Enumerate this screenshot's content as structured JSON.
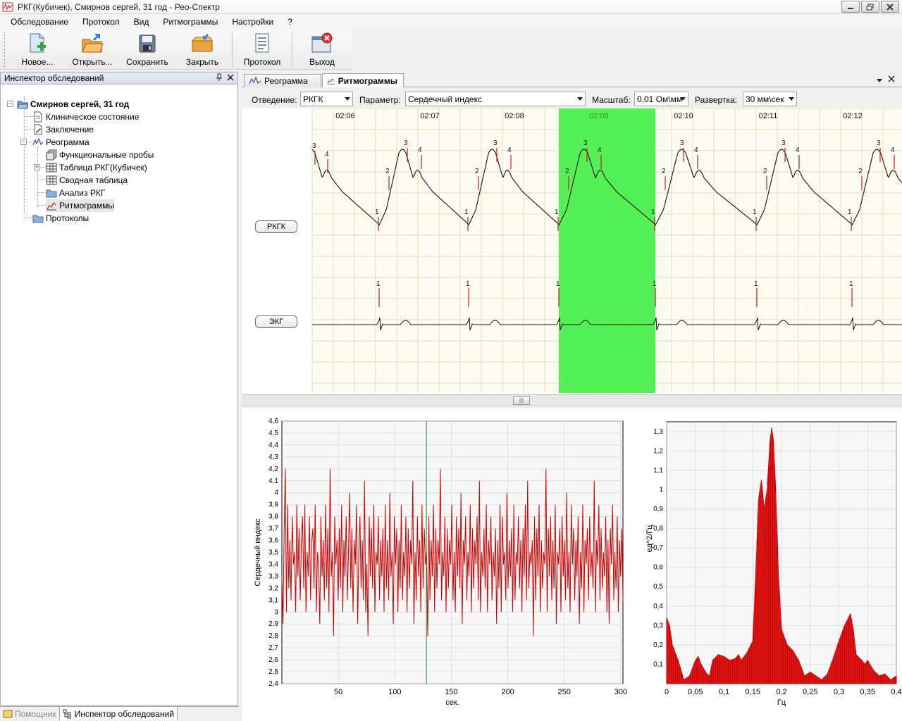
{
  "window": {
    "title": "РКГ(Кубичек), Смирнов сергей, 31 год - Рео-Спектр"
  },
  "menu": [
    "Обследование",
    "Протокол",
    "Вид",
    "Ритмограммы",
    "Настройки",
    "?"
  ],
  "toolbar": {
    "buttons": [
      {
        "label": "Новое...",
        "icon": "new-document-icon"
      },
      {
        "label": "Открыть...",
        "icon": "open-folder-icon"
      },
      {
        "label": "Сохранить",
        "icon": "save-disk-icon"
      },
      {
        "label": "Закрыть",
        "icon": "close-folder-icon"
      },
      {
        "label": "Протокол",
        "icon": "protocol-document-icon"
      },
      {
        "label": "Выход",
        "icon": "exit-icon"
      }
    ]
  },
  "inspector": {
    "title": "Инспектор обследований",
    "root": "Смирнов сергей, 31 год",
    "items": [
      {
        "label": "Клиническое состояние",
        "icon": "document-icon"
      },
      {
        "label": "Заключение",
        "icon": "pencil-document-icon"
      },
      {
        "label": "Реограмма",
        "icon": "waveform-icon"
      },
      {
        "label": "Функциональные пробы",
        "icon": "stacked-pages-icon"
      },
      {
        "label": "Таблица РКГ(Кубичек)",
        "icon": "table-icon"
      },
      {
        "label": "Сводная таблица",
        "icon": "table-icon"
      },
      {
        "label": "Анализ РКГ",
        "icon": "folder-icon"
      },
      {
        "label": "Ритмограммы",
        "icon": "chart-line-icon"
      },
      {
        "label": "Протоколы",
        "icon": "folder-icon"
      }
    ],
    "bottom_tabs": [
      "Помощник",
      "Инспектор обследований"
    ]
  },
  "doc_tabs": [
    "Реограмма",
    "Ритмограммы"
  ],
  "controls": {
    "lead_label": "Отведение:",
    "lead_value": "РКГК",
    "param_label": "Параметр:",
    "param_value": "Сердечный индекс",
    "scale_label": "Масштаб:",
    "scale_value": "0,01 Ом\\мм",
    "sweep_label": "Развертка:",
    "sweep_value": "30 мм\\сек"
  },
  "signal": {
    "time_labels": [
      "02:06",
      "02:07",
      "02:08",
      "02:09",
      "02:10",
      "02:11",
      "02:12"
    ],
    "selected_time": "02:09",
    "leads": [
      "РКГК",
      "ЭКГ"
    ],
    "highlight_color": "#4cef4c",
    "marker_labels": [
      "1",
      "2",
      "3",
      "4"
    ]
  },
  "chart_data": [
    {
      "type": "line",
      "ylabel": "Сердечный индекс",
      "xlabel": "сек.",
      "xlim": [
        0,
        302
      ],
      "ylim": [
        2.4,
        4.6
      ],
      "xticks": [
        50,
        100,
        150,
        200,
        250,
        300
      ],
      "yticks": [
        "2,4",
        "2,5",
        "2,6",
        "2,7",
        "2,8",
        "2,9",
        "3",
        "3,1",
        "3,2",
        "3,3",
        "3,4",
        "3,5",
        "3,6",
        "3,7",
        "3,8",
        "3,9",
        "4",
        "4,1",
        "4,2",
        "4,3",
        "4,4",
        "4,5",
        "4,6"
      ],
      "cursor_x": 128,
      "series_color": "#cc0000",
      "y": [
        3.3,
        2.9,
        3.7,
        4.2,
        3.0,
        3.9,
        3.2,
        3.6,
        3.1,
        3.8,
        3.4,
        3.5,
        3.0,
        3.9,
        3.3,
        3.7,
        3.1,
        3.6,
        3.8,
        3.2,
        3.9,
        3.0,
        3.5,
        3.3,
        3.8,
        3.1,
        3.6,
        3.7,
        3.2,
        3.9,
        3.0,
        3.5,
        3.4,
        2.9,
        3.8,
        3.3,
        3.6,
        3.1,
        3.9,
        3.2,
        3.7,
        3.0,
        4.2,
        3.3,
        3.5,
        2.8,
        3.8,
        3.4,
        3.6,
        3.1,
        3.7,
        3.2,
        3.9,
        3.0,
        3.6,
        3.3,
        3.8,
        3.1,
        3.5,
        4.0,
        3.2,
        3.7,
        3.0,
        3.6,
        3.4,
        3.9,
        2.9,
        3.5,
        3.8,
        3.2,
        3.6,
        3.1,
        4.1,
        3.0,
        3.4,
        2.8,
        3.8,
        3.3,
        3.7,
        3.2,
        3.9,
        3.0,
        3.5,
        3.4,
        3.8,
        3.1,
        3.6,
        3.3,
        3.7,
        3.0,
        3.9,
        3.2,
        3.6,
        3.1,
        4.0,
        3.3,
        3.5,
        2.9,
        3.8,
        3.4,
        3.7,
        3.0,
        3.6,
        3.2,
        3.9,
        3.1,
        3.5,
        3.3,
        3.8,
        3.0,
        3.7,
        3.2,
        3.6,
        3.4,
        4.1,
        2.9,
        3.5,
        3.1,
        3.8,
        3.3,
        3.6,
        3.0,
        3.9,
        3.2,
        3.7,
        3.4,
        3.5,
        2.8,
        3.8,
        3.1,
        3.6,
        3.3,
        3.9,
        3.0,
        3.7,
        3.2,
        3.6,
        3.4,
        4.2,
        3.1,
        3.5,
        3.3,
        3.8,
        3.0,
        3.7,
        3.2,
        3.6,
        3.4,
        3.9,
        3.1,
        3.5,
        3.0,
        3.8,
        3.3,
        3.7,
        3.2,
        4.0,
        2.9,
        3.6,
        3.4,
        3.8,
        3.1,
        3.5,
        3.3,
        3.9,
        3.0,
        3.7,
        3.2,
        3.6,
        3.4,
        3.8,
        3.1,
        4.1,
        3.0,
        3.5,
        3.3,
        3.7,
        3.2,
        3.9,
        3.0,
        3.6,
        3.4,
        3.8,
        3.1,
        3.5,
        3.3,
        3.7,
        2.9,
        3.6,
        3.2,
        3.9,
        3.0,
        3.8,
        3.4,
        3.5,
        3.1,
        4.0,
        3.2,
        3.6,
        3.3,
        3.7,
        3.0,
        3.9,
        3.1,
        3.5,
        3.4,
        3.8,
        3.2,
        3.6,
        3.0,
        3.7,
        3.3,
        3.9,
        3.1,
        4.1,
        3.2,
        3.5,
        3.4,
        3.6,
        2.8,
        3.8,
        3.1,
        3.7,
        3.3,
        3.9,
        3.0,
        3.6,
        3.2,
        3.5,
        3.4,
        4.2,
        3.0,
        3.7,
        3.3,
        3.8,
        3.1,
        3.6,
        3.2,
        3.9,
        2.9,
        3.5,
        3.4,
        3.7,
        3.0,
        3.8,
        3.3,
        3.6,
        3.1,
        4.0,
        3.2,
        3.5,
        3.0,
        3.9,
        3.4,
        3.7,
        3.1,
        3.6,
        3.3,
        3.8,
        2.9,
        3.5,
        3.2,
        3.9,
        3.0,
        3.6,
        3.4,
        3.7,
        3.1,
        3.8,
        3.3,
        3.5,
        3.2,
        4.1,
        3.0,
        3.6,
        3.4,
        3.9,
        3.1,
        3.7,
        3.2,
        3.5,
        3.3,
        3.8,
        3.0,
        3.6,
        2.9,
        3.7,
        3.4,
        3.9,
        3.1,
        3.5,
        3.2,
        3.8,
        3.0,
        3.6,
        3.3,
        3.7,
        3.1
      ]
    },
    {
      "type": "area",
      "ylabel": "ед^2/Гц",
      "xlabel": "Гц",
      "xlim": [
        0,
        0.4
      ],
      "ylim": [
        0,
        1.35
      ],
      "xticks": [
        "0",
        "0,05",
        "0,1",
        "0,15",
        "0,2",
        "0,25",
        "0,3",
        "0,35",
        "0,4"
      ],
      "yticks": [
        "0,1",
        "0,2",
        "0,3",
        "0,4",
        "0,5",
        "0,6",
        "0,7",
        "0,8",
        "0,9",
        "1",
        "1,1",
        "1,2",
        "1,3"
      ],
      "series_color": "#cc0000",
      "points": [
        [
          0,
          0.34
        ],
        [
          0.005,
          0.3
        ],
        [
          0.01,
          0.2
        ],
        [
          0.02,
          0.12
        ],
        [
          0.03,
          0.02
        ],
        [
          0.04,
          0.04
        ],
        [
          0.05,
          0.12
        ],
        [
          0.055,
          0.14
        ],
        [
          0.06,
          0.1
        ],
        [
          0.07,
          0.05
        ],
        [
          0.075,
          0.04
        ],
        [
          0.08,
          0.12
        ],
        [
          0.09,
          0.15
        ],
        [
          0.1,
          0.14
        ],
        [
          0.11,
          0.12
        ],
        [
          0.12,
          0.13
        ],
        [
          0.125,
          0.15
        ],
        [
          0.13,
          0.12
        ],
        [
          0.14,
          0.16
        ],
        [
          0.15,
          0.22
        ],
        [
          0.155,
          0.55
        ],
        [
          0.16,
          0.95
        ],
        [
          0.165,
          1.05
        ],
        [
          0.17,
          0.9
        ],
        [
          0.175,
          1.0
        ],
        [
          0.18,
          1.25
        ],
        [
          0.183,
          1.32
        ],
        [
          0.186,
          1.25
        ],
        [
          0.19,
          1.0
        ],
        [
          0.195,
          0.55
        ],
        [
          0.2,
          0.28
        ],
        [
          0.21,
          0.2
        ],
        [
          0.22,
          0.17
        ],
        [
          0.23,
          0.12
        ],
        [
          0.24,
          0.04
        ],
        [
          0.25,
          0.06
        ],
        [
          0.26,
          0.04
        ],
        [
          0.27,
          0.02
        ],
        [
          0.28,
          0.05
        ],
        [
          0.29,
          0.13
        ],
        [
          0.3,
          0.22
        ],
        [
          0.31,
          0.3
        ],
        [
          0.32,
          0.36
        ],
        [
          0.325,
          0.28
        ],
        [
          0.33,
          0.15
        ],
        [
          0.34,
          0.12
        ],
        [
          0.345,
          0.1
        ],
        [
          0.35,
          0.12
        ],
        [
          0.36,
          0.07
        ],
        [
          0.37,
          0.04
        ],
        [
          0.38,
          0.05
        ],
        [
          0.39,
          0.02
        ],
        [
          0.4,
          0.04
        ]
      ]
    }
  ]
}
